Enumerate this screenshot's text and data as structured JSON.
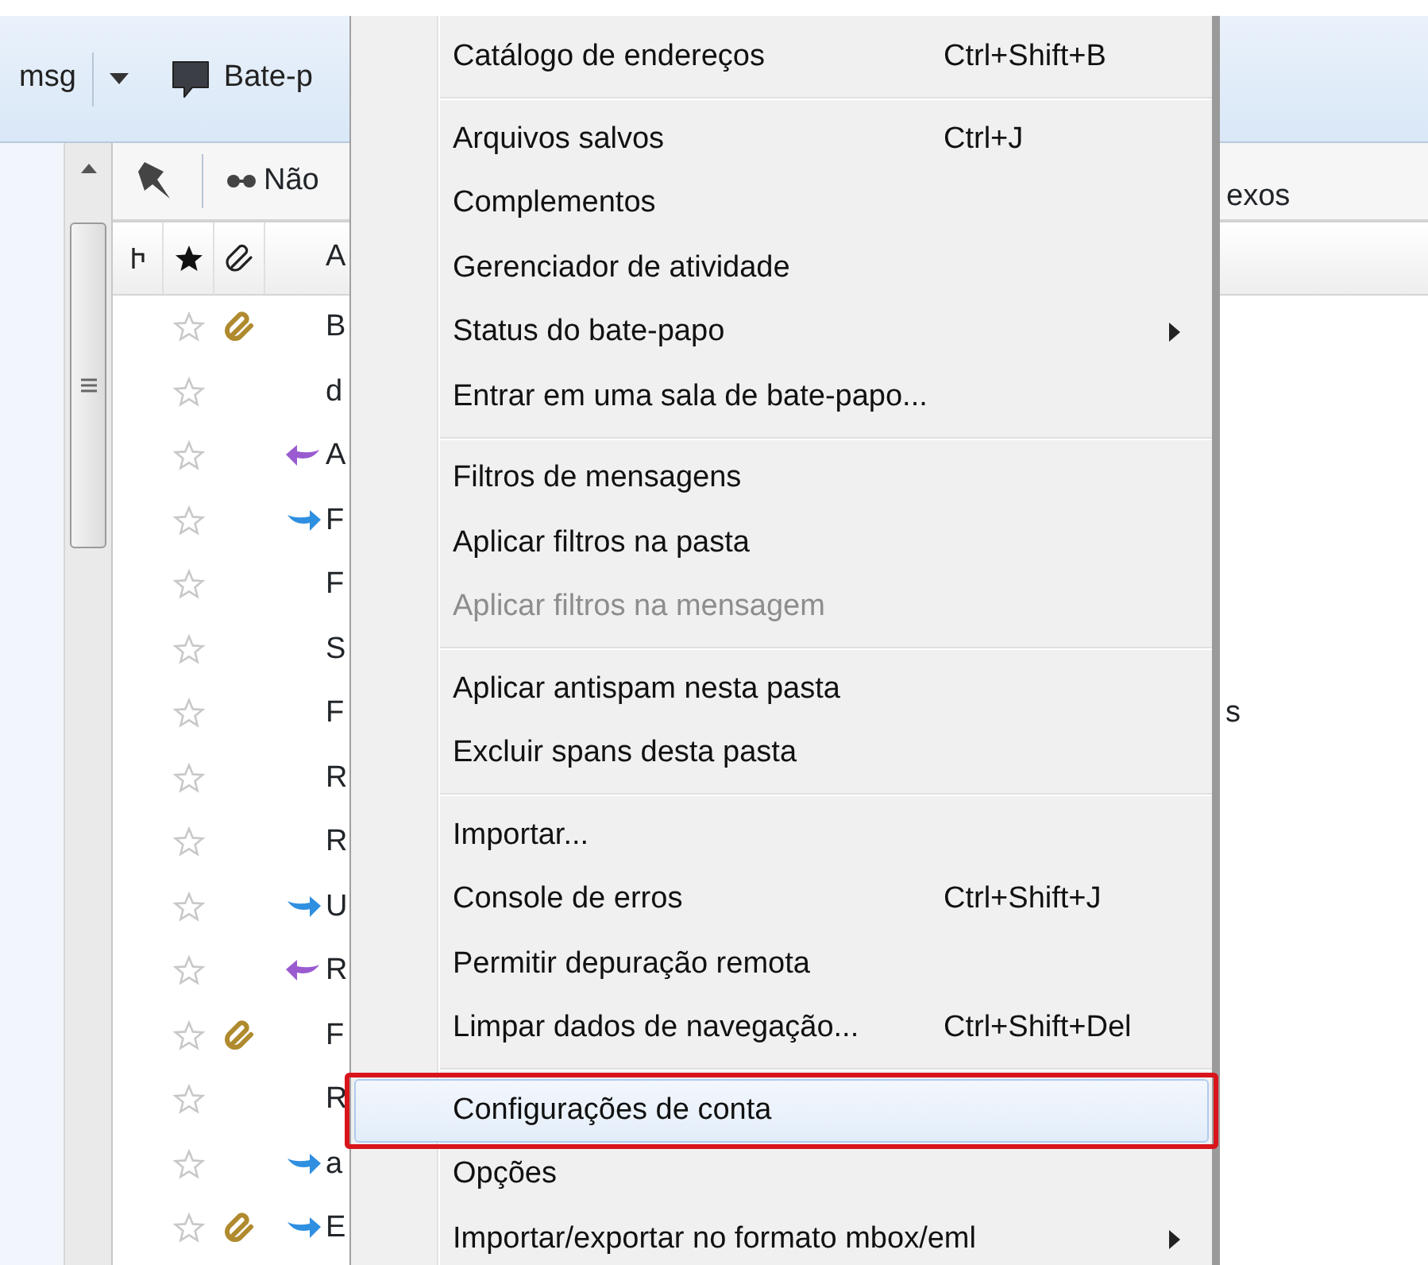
{
  "toolbar": {
    "items": [
      {
        "kind": "text",
        "label": "msg"
      },
      {
        "kind": "dropdown"
      },
      {
        "kind": "chat",
        "label": "Bate-p"
      }
    ]
  },
  "quick_filter": {
    "label": "Não",
    "column_4_text": "exos"
  },
  "columns": [
    {
      "kind": "thread"
    },
    {
      "kind": "star"
    },
    {
      "kind": "attachment"
    },
    {
      "kind": "text",
      "label": "A"
    }
  ],
  "messages": [
    {
      "subject": "B",
      "starred": false,
      "attachment": true,
      "replied": false,
      "forwarded": false
    },
    {
      "subject": "d",
      "starred": false,
      "attachment": false,
      "replied": false,
      "forwarded": false
    },
    {
      "subject": "A",
      "starred": false,
      "attachment": false,
      "replied": true,
      "forwarded": false
    },
    {
      "subject": "F",
      "starred": false,
      "attachment": false,
      "replied": false,
      "forwarded": true
    },
    {
      "subject": "F",
      "starred": false,
      "attachment": false,
      "replied": false,
      "forwarded": false
    },
    {
      "subject": "S",
      "starred": false,
      "attachment": false,
      "replied": false,
      "forwarded": false
    },
    {
      "subject": "F",
      "starred": false,
      "attachment": false,
      "replied": false,
      "forwarded": false,
      "column_4": "s"
    },
    {
      "subject": "R",
      "starred": false,
      "attachment": false,
      "replied": false,
      "forwarded": false
    },
    {
      "subject": "R",
      "starred": false,
      "attachment": false,
      "replied": false,
      "forwarded": false
    },
    {
      "subject": "U",
      "starred": false,
      "attachment": false,
      "replied": false,
      "forwarded": true
    },
    {
      "subject": "R",
      "starred": false,
      "attachment": false,
      "replied": true,
      "forwarded": false
    },
    {
      "subject": "F",
      "starred": false,
      "attachment": true,
      "replied": false,
      "forwarded": false
    },
    {
      "subject": "R",
      "starred": false,
      "attachment": false,
      "replied": false,
      "forwarded": false
    },
    {
      "subject": "a",
      "starred": false,
      "attachment": false,
      "replied": false,
      "forwarded": true
    },
    {
      "subject": "E",
      "starred": false,
      "attachment": true,
      "replied": false,
      "forwarded": true
    }
  ],
  "menu": {
    "sections": [
      [
        {
          "label": "Catálogo de endereços",
          "shortcut": "Ctrl+Shift+B",
          "submenu": false,
          "disabled": false,
          "selected": false,
          "callout": false
        }
      ],
      [
        {
          "label": "Arquivos salvos",
          "shortcut": "Ctrl+J",
          "submenu": false,
          "disabled": false,
          "selected": false,
          "callout": false
        },
        {
          "label": "Complementos",
          "submenu": false,
          "disabled": false,
          "selected": false,
          "callout": false
        },
        {
          "label": "Gerenciador de atividade",
          "submenu": false,
          "disabled": false,
          "selected": false,
          "callout": false
        },
        {
          "label": "Status do bate-papo",
          "submenu": true,
          "disabled": false,
          "selected": false,
          "callout": false
        },
        {
          "label": "Entrar em uma sala de bate-papo...",
          "submenu": false,
          "disabled": false,
          "selected": false,
          "callout": false
        }
      ],
      [
        {
          "label": "Filtros de mensagens",
          "submenu": false,
          "disabled": false,
          "selected": false,
          "callout": false
        },
        {
          "label": "Aplicar filtros na pasta",
          "submenu": false,
          "disabled": false,
          "selected": false,
          "callout": false
        },
        {
          "label": "Aplicar filtros na mensagem",
          "submenu": false,
          "disabled": true,
          "selected": false,
          "callout": false
        }
      ],
      [
        {
          "label": "Aplicar antispam nesta pasta",
          "submenu": false,
          "disabled": false,
          "selected": false,
          "callout": false
        },
        {
          "label": "Excluir spans desta pasta",
          "submenu": false,
          "disabled": false,
          "selected": false,
          "callout": false
        }
      ],
      [
        {
          "label": "Importar...",
          "submenu": false,
          "disabled": false,
          "selected": false,
          "callout": false
        },
        {
          "label": "Console de erros",
          "shortcut": "Ctrl+Shift+J",
          "submenu": false,
          "disabled": false,
          "selected": false,
          "callout": false
        },
        {
          "label": "Permitir depuração remota",
          "submenu": false,
          "disabled": false,
          "selected": false,
          "callout": false
        },
        {
          "label": "Limpar dados de navegação...",
          "shortcut": "Ctrl+Shift+Del",
          "submenu": false,
          "disabled": false,
          "selected": false,
          "callout": false
        }
      ],
      [
        {
          "label": "Configurações de conta",
          "submenu": false,
          "disabled": false,
          "selected": true,
          "callout": true
        },
        {
          "label": "Opções",
          "submenu": false,
          "disabled": false,
          "selected": false,
          "callout": false
        },
        {
          "label": "Importar/exportar no formato mbox/eml",
          "submenu": true,
          "disabled": false,
          "selected": false,
          "callout": false
        }
      ]
    ]
  }
}
